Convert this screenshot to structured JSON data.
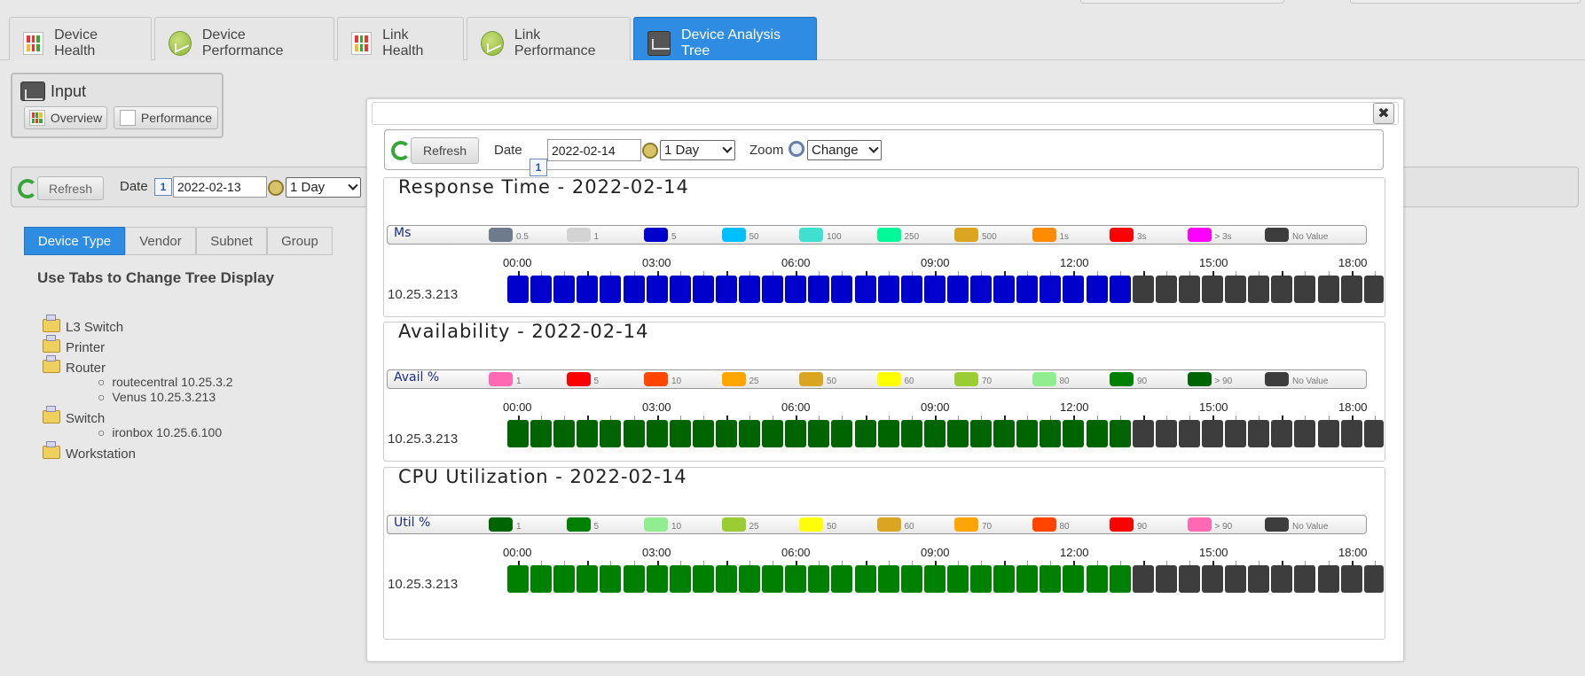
{
  "main_tabs": [
    {
      "label": "Device Health",
      "icon": "health-grid-icon",
      "active": false
    },
    {
      "label": "Device Performance",
      "icon": "performance-gauge-icon",
      "active": false
    },
    {
      "label": "Link Health",
      "icon": "health-grid-icon",
      "active": false
    },
    {
      "label": "Link Performance",
      "icon": "performance-gauge-icon",
      "active": false
    },
    {
      "label": "Device Analysis Tree",
      "icon": "analysis-chart-icon",
      "active": true
    }
  ],
  "input_panel": {
    "title": "Input",
    "overview_label": "Overview",
    "performance_label": "Performance"
  },
  "background_toolbar": {
    "refresh_label": "Refresh",
    "date_label": "Date",
    "date_value": "2022-02-13",
    "period_value": "1 Day"
  },
  "sub_tabs": [
    {
      "label": "Device Type",
      "active": true
    },
    {
      "label": "Vendor",
      "active": false
    },
    {
      "label": "Subnet",
      "active": false
    },
    {
      "label": "Group",
      "active": false
    }
  ],
  "tree_hint": "Use Tabs to Change Tree Display",
  "tree": [
    {
      "label": "L3 Switch",
      "children": []
    },
    {
      "label": "Printer",
      "children": []
    },
    {
      "label": "Router",
      "children": [
        "routecentral 10.25.3.2",
        "Venus 10.25.3.213"
      ]
    },
    {
      "label": "Switch",
      "children": [
        "ironbox 10.25.6.100"
      ]
    },
    {
      "label": "Workstation",
      "children": []
    }
  ],
  "modal": {
    "close_label": "✖",
    "toolbar": {
      "refresh_label": "Refresh",
      "date_label": "Date",
      "date_value": "2022-02-14",
      "period_value": "1 Day",
      "zoom_label": "Zoom",
      "zoom_value": "Change"
    },
    "hour_labels": [
      "00:00",
      "03:00",
      "06:00",
      "09:00",
      "12:00",
      "15:00",
      "18:00"
    ],
    "device": "10.25.3.213",
    "no_value_color": "#3d3d3d",
    "charts": [
      {
        "title": "Response Time - 2022-02-14",
        "unit": "Ms",
        "legend": [
          {
            "label": "0.5",
            "color": "#6d7b8d"
          },
          {
            "label": "1",
            "color": "#d3d3d3"
          },
          {
            "label": "5",
            "color": "#0000cd"
          },
          {
            "label": "50",
            "color": "#00bfff"
          },
          {
            "label": "100",
            "color": "#40e0d0"
          },
          {
            "label": "250",
            "color": "#00fa9a"
          },
          {
            "label": "500",
            "color": "#daa520"
          },
          {
            "label": "1s",
            "color": "#ff8c00"
          },
          {
            "label": "3s",
            "color": "#ff0000"
          },
          {
            "label": "> 3s",
            "color": "#ff00ff"
          },
          {
            "label": "No Value",
            "color": "#3d3d3d"
          }
        ],
        "cell_color": "#0000cd"
      },
      {
        "title": "Availability - 2022-02-14",
        "unit": "Avail %",
        "legend": [
          {
            "label": "1",
            "color": "#ff69b4"
          },
          {
            "label": "5",
            "color": "#ff0000"
          },
          {
            "label": "10",
            "color": "#ff4500"
          },
          {
            "label": "25",
            "color": "#ffa500"
          },
          {
            "label": "50",
            "color": "#daa520"
          },
          {
            "label": "60",
            "color": "#ffff00"
          },
          {
            "label": "70",
            "color": "#9acd32"
          },
          {
            "label": "80",
            "color": "#90ee90"
          },
          {
            "label": "90",
            "color": "#008000"
          },
          {
            "label": "> 90",
            "color": "#006400"
          },
          {
            "label": "No Value",
            "color": "#3d3d3d"
          }
        ],
        "cell_color": "#006400"
      },
      {
        "title": "CPU Utilization - 2022-02-14",
        "unit": "Util %",
        "legend": [
          {
            "label": "1",
            "color": "#006400"
          },
          {
            "label": "5",
            "color": "#008000"
          },
          {
            "label": "10",
            "color": "#90ee90"
          },
          {
            "label": "25",
            "color": "#9acd32"
          },
          {
            "label": "50",
            "color": "#ffff00"
          },
          {
            "label": "60",
            "color": "#daa520"
          },
          {
            "label": "70",
            "color": "#ffa500"
          },
          {
            "label": "80",
            "color": "#ff4500"
          },
          {
            "label": "90",
            "color": "#ff0000"
          },
          {
            "label": "> 90",
            "color": "#ff69b4"
          },
          {
            "label": "No Value",
            "color": "#3d3d3d"
          }
        ],
        "cell_color": "#008000"
      }
    ],
    "cells_with_data": 27,
    "cells_no_value": 11
  }
}
